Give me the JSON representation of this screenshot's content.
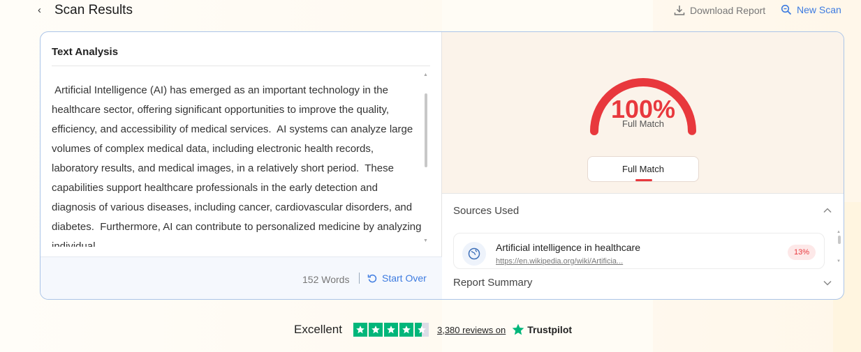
{
  "header": {
    "title": "Scan Results",
    "download_label": "Download Report",
    "new_scan_label": "New Scan"
  },
  "text_analysis": {
    "title": "Text Analysis",
    "body": " Artificial Intelligence (AI) has emerged as an important technology in the healthcare sector, offering significant opportunities to improve the quality, efficiency, and accessibility of medical services.  AI systems can analyze large volumes of complex medical data, including electronic health records, laboratory results, and medical images, in a relatively short period.  These capabilities support healthcare professionals in the early detection and diagnosis of various diseases, including cancer, cardiovascular disorders, and diabetes.  Furthermore, AI can contribute to personalized medicine by analyzing individual",
    "word_count": "152 Words",
    "start_over_label": "Start Over"
  },
  "result": {
    "percent_text": "100%",
    "percent_value": 100,
    "gauge_label": "Full Match",
    "pill_label": "Full Match",
    "accent": "#e8383d"
  },
  "sources": {
    "heading": "Sources Used",
    "items": [
      {
        "title": "Artificial intelligence in healthcare",
        "url": "https://en.wikipedia.org/wiki/Artificia...",
        "match": "13%",
        "icon": "globe-icon"
      }
    ]
  },
  "report_summary": {
    "heading": "Report Summary"
  },
  "trustpilot": {
    "rating_word": "Excellent",
    "reviews_text": "3,380 reviews on",
    "brand": "Trustpilot",
    "stars": 4.5,
    "brand_color": "#00b67a"
  }
}
